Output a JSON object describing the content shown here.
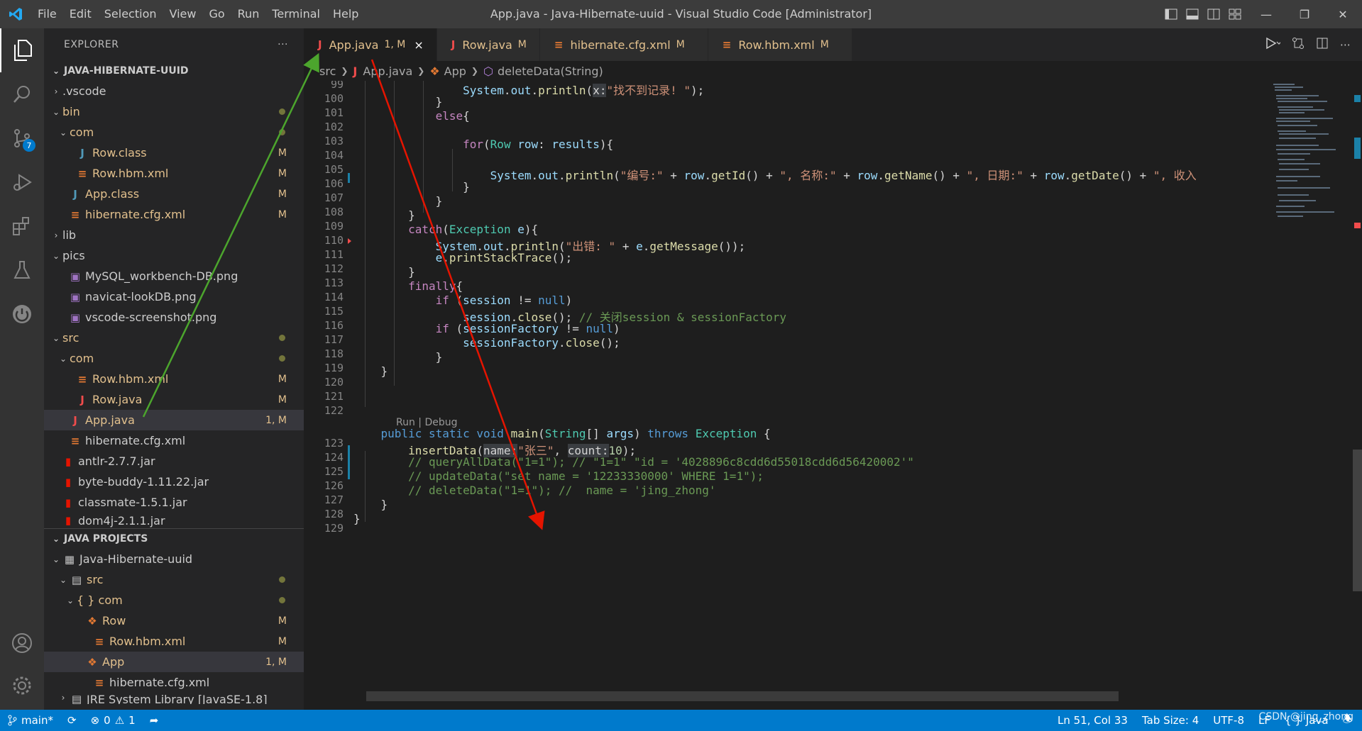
{
  "app": {
    "window_title": "App.java - Java-Hibernate-uuid - Visual Studio Code [Administrator]",
    "menu": [
      "File",
      "Edit",
      "Selection",
      "View",
      "Go",
      "Run",
      "Terminal",
      "Help"
    ]
  },
  "activity_bar": {
    "items": [
      "files-icon",
      "search-icon",
      "source-control-icon",
      "run-debug-icon",
      "extensions-icon",
      "testing-icon",
      "remote-icon"
    ],
    "source_control_badge": "7",
    "bottom": [
      "account-icon",
      "settings-gear-icon"
    ]
  },
  "sidebar": {
    "title": "EXPLORER",
    "more": "···",
    "explorer_section": "JAVA-HIBERNATE-UUID",
    "tree": [
      {
        "label": ".vscode",
        "icon": "chev-right"
      },
      {
        "label": "bin",
        "icon": "chev-down",
        "dot": true
      },
      {
        "label": "com",
        "icon": "chev-down",
        "dot": true
      },
      {
        "label": "Row.class",
        "icon": "J",
        "status": "M"
      },
      {
        "label": "Row.hbm.xml",
        "icon": "xml",
        "status": "M"
      },
      {
        "label": "App.class",
        "icon": "J",
        "status": "M"
      },
      {
        "label": "hibernate.cfg.xml",
        "icon": "xml",
        "status": "M"
      },
      {
        "label": "lib",
        "icon": "chev-right"
      },
      {
        "label": "pics",
        "icon": "chev-down"
      },
      {
        "label": "MySQL_workbench-DB.png",
        "icon": "png"
      },
      {
        "label": "navicat-lookDB.png",
        "icon": "png"
      },
      {
        "label": "vscode-screenshot.png",
        "icon": "png"
      },
      {
        "label": "src",
        "icon": "chev-down",
        "dot": true
      },
      {
        "label": "com",
        "icon": "chev-down",
        "dot": true
      },
      {
        "label": "Row.hbm.xml",
        "icon": "xml",
        "status": "M"
      },
      {
        "label": "Row.java",
        "icon": "java",
        "status": "M"
      },
      {
        "label": "App.java",
        "icon": "java",
        "status": "1, M"
      },
      {
        "label": "hibernate.cfg.xml",
        "icon": "xml"
      },
      {
        "label": "antlr-2.7.7.jar",
        "icon": "jar"
      },
      {
        "label": "byte-buddy-1.11.22.jar",
        "icon": "jar"
      },
      {
        "label": "classmate-1.5.1.jar",
        "icon": "jar"
      },
      {
        "label": "dom4j-2.1.1.jar",
        "icon": "jar"
      }
    ],
    "projects_section": "JAVA PROJECTS",
    "projects": [
      {
        "label": "Java-Hibernate-uuid"
      },
      {
        "label": "src",
        "dot": true
      },
      {
        "label": "{ } com",
        "dot": true
      },
      {
        "label": "Row",
        "status": "M"
      },
      {
        "label": "Row.hbm.xml",
        "status": "M"
      },
      {
        "label": "App",
        "status": "1, M"
      },
      {
        "label": "hibernate.cfg.xml"
      },
      {
        "label": "JRE System Library [JavaSE-1.8]"
      }
    ]
  },
  "tabs": [
    {
      "label": "App.java",
      "status": "1, M",
      "close": "×"
    },
    {
      "label": "Row.java",
      "status": "M"
    },
    {
      "label": "hibernate.cfg.xml",
      "status": "M"
    },
    {
      "label": "Row.hbm.xml",
      "status": "M"
    }
  ],
  "breadcrumb": {
    "items": [
      "src",
      "App.java",
      "App",
      "deleteData(String)"
    ]
  },
  "editor": {
    "codelens": "Run | Debug",
    "line_numbers": [
      "99",
      "100",
      "101",
      "102",
      "103",
      "104",
      "105",
      "106",
      "107",
      "108",
      "109",
      "110",
      "111",
      "112",
      "113",
      "114",
      "115",
      "116",
      "117",
      "118",
      "119",
      "120",
      "121",
      "122",
      "123",
      "124",
      "125",
      "126",
      "127",
      "128",
      "129"
    ]
  },
  "status_bar": {
    "branch": "main*",
    "errors": "0",
    "warnings": "1",
    "position": "Ln 51, Col 33",
    "tab_size": "Tab Size: 4",
    "encoding": "UTF-8",
    "eol": "LF",
    "language": "Java",
    "watermark": "CSDN @jing_zhong"
  }
}
